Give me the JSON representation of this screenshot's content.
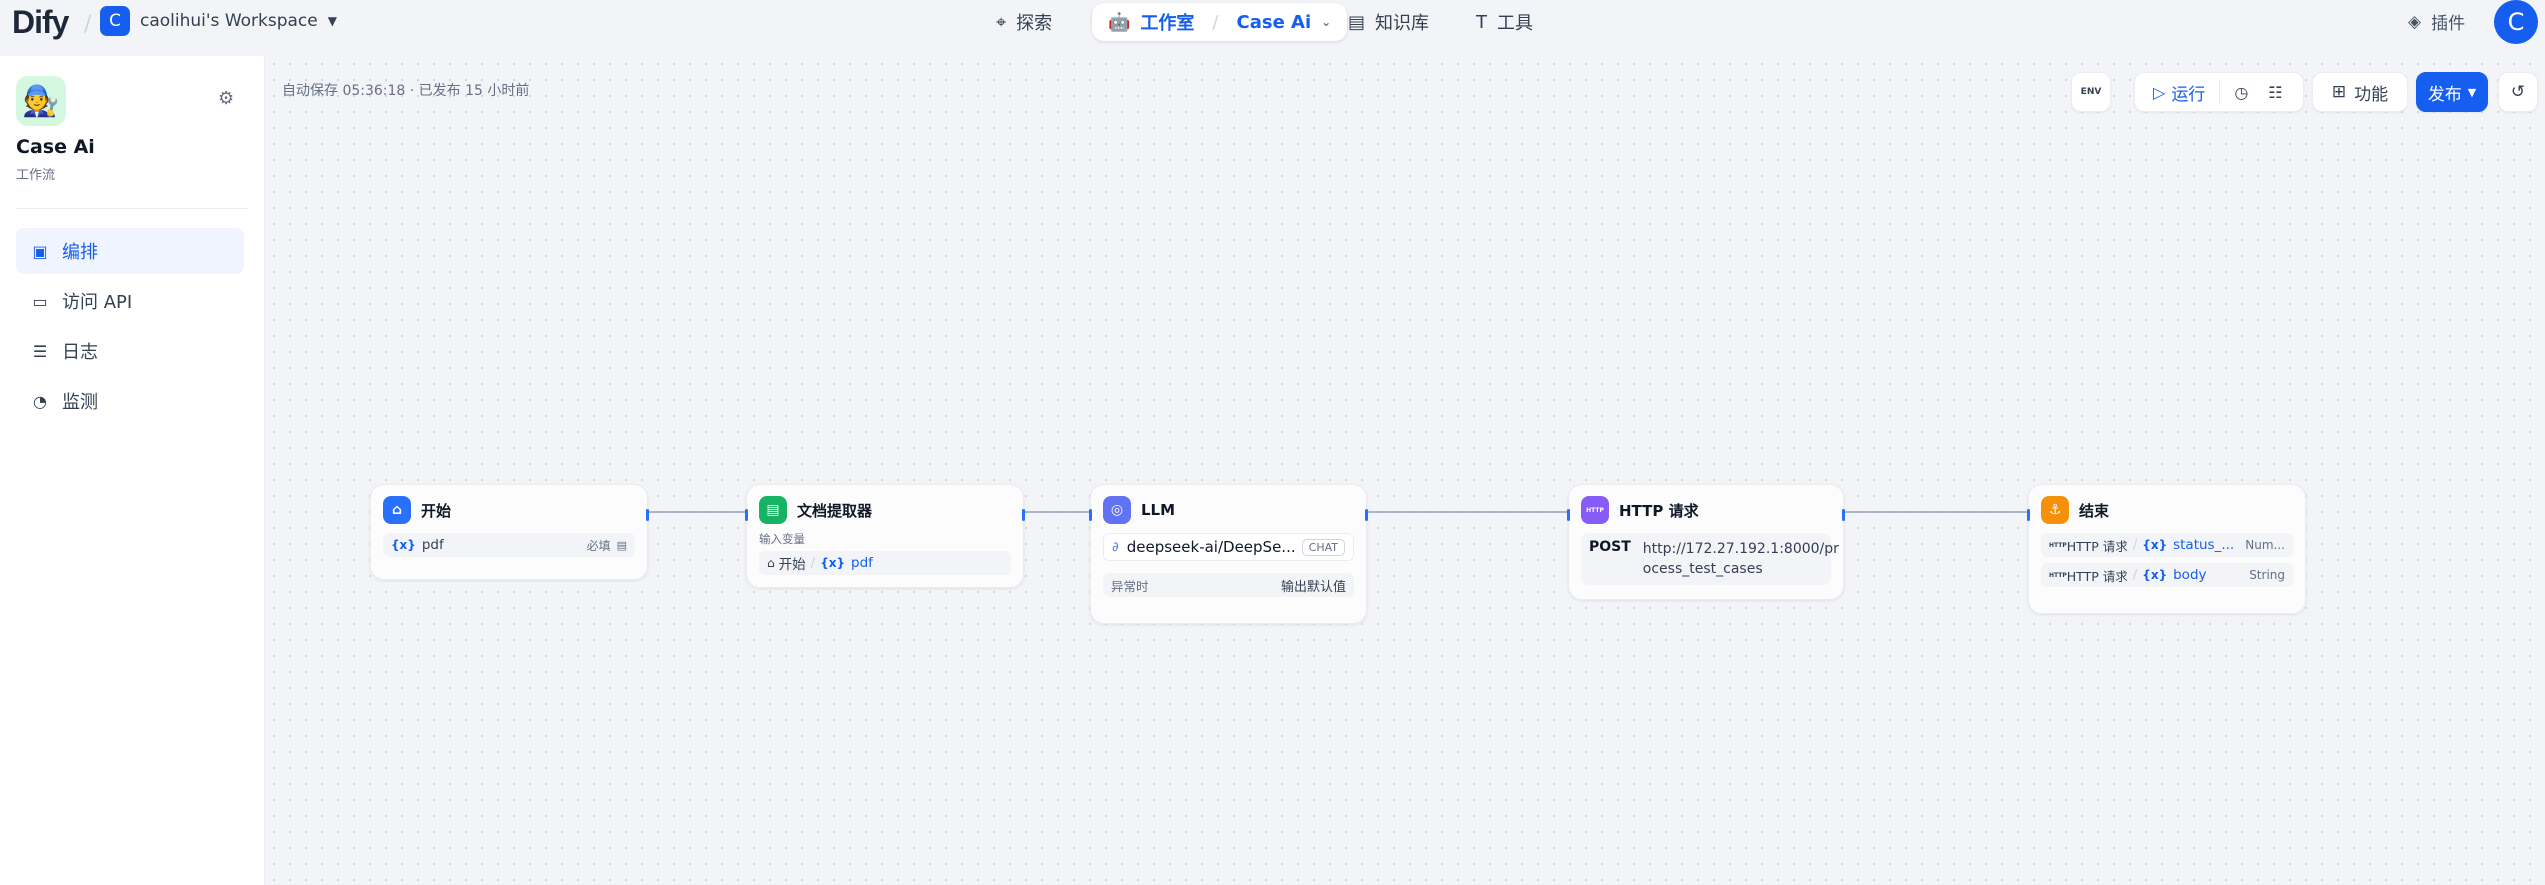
{
  "header": {
    "logo": "Dify",
    "workspace": {
      "initial": "C",
      "name": "caolihui's Workspace"
    },
    "nav": {
      "explore": "探索",
      "studio": "工作室",
      "app": "Case Ai",
      "knowledge": "知识库",
      "tools": "工具"
    },
    "plugins": "插件",
    "user_initial": "C"
  },
  "sidebar": {
    "app_name": "Case Ai",
    "app_type": "工作流",
    "items": [
      {
        "label": "编排",
        "icon": "layout-icon",
        "active": true
      },
      {
        "label": "访问 API",
        "icon": "terminal-icon",
        "active": false
      },
      {
        "label": "日志",
        "icon": "log-icon",
        "active": false
      },
      {
        "label": "监测",
        "icon": "monitor-icon",
        "active": false
      }
    ]
  },
  "canvas": {
    "autosave": "自动保存 05:36:18 · 已发布 15 小时前",
    "toolbar": {
      "env": "ENV",
      "run": "运行",
      "features": "功能",
      "publish": "发布"
    }
  },
  "nodes": {
    "start": {
      "title": "开始",
      "var_symbol": "{x}",
      "var_name": "pdf",
      "required": "必填"
    },
    "doc": {
      "title": "文档提取器",
      "input_label": "输入变量",
      "source": "开始",
      "var_symbol": "{x}",
      "var_name": "pdf"
    },
    "llm": {
      "title": "LLM",
      "model": "deepseek-ai/DeepSe...",
      "mode": "CHAT",
      "error_label": "异常时",
      "error_value": "输出默认值"
    },
    "http": {
      "title": "HTTP 请求",
      "method": "POST",
      "url_line1": "http://172.27.192.1:8000/pr",
      "url_line2": "ocess_test_cases"
    },
    "end": {
      "title": "结束",
      "outputs": [
        {
          "source": "HTTP 请求",
          "var_symbol": "{x}",
          "var": "status_...",
          "type": "Num..."
        },
        {
          "source": "HTTP 请求",
          "var_symbol": "{x}",
          "var": "body",
          "type": "String"
        }
      ]
    }
  },
  "colors": {
    "accent": "#155eef",
    "start_icon": "#2970ff",
    "doc_icon": "#16b364",
    "llm_icon": "#6172f3",
    "http_icon": "#875bf7",
    "end_icon": "#f79009"
  }
}
